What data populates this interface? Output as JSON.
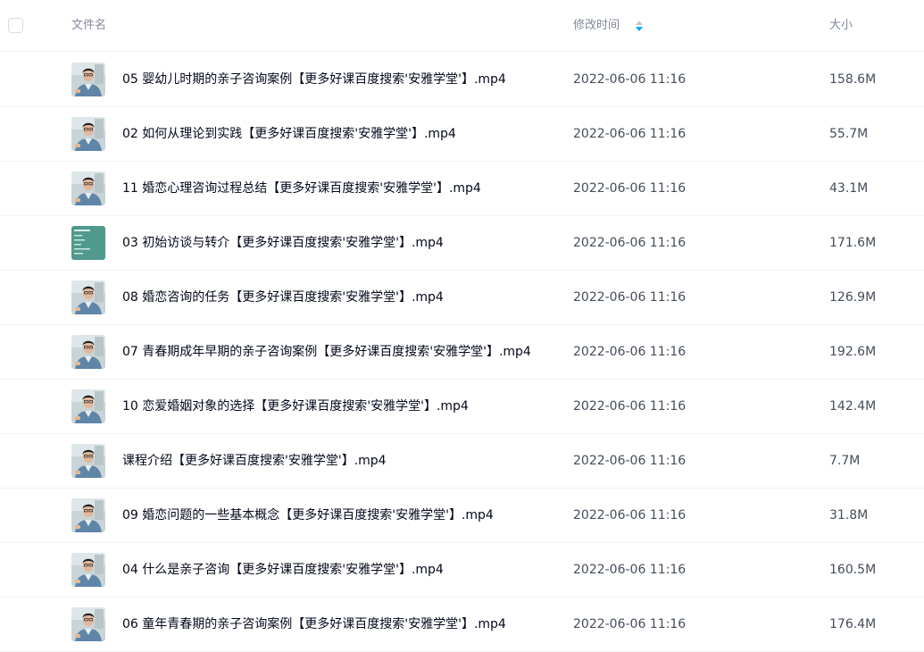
{
  "header": {
    "name_label": "文件名",
    "time_label": "修改时间",
    "size_label": "大小",
    "accent_color": "#06a7ff"
  },
  "files": [
    {
      "name": "05 婴幼儿时期的亲子咨询案例【更多好课百度搜索'安雅学堂'】.mp4",
      "time": "2022-06-06 11:16",
      "size": "158.6M",
      "thumb": "person"
    },
    {
      "name": "02 如何从理论到实践【更多好课百度搜索'安雅学堂'】.mp4",
      "time": "2022-06-06 11:16",
      "size": "55.7M",
      "thumb": "person"
    },
    {
      "name": "11 婚恋心理咨询过程总结【更多好课百度搜索'安雅学堂'】.mp4",
      "time": "2022-06-06 11:16",
      "size": "43.1M",
      "thumb": "person"
    },
    {
      "name": "03 初始访谈与转介【更多好课百度搜索'安雅学堂'】.mp4",
      "time": "2022-06-06 11:16",
      "size": "171.6M",
      "thumb": "slide"
    },
    {
      "name": "08 婚恋咨询的任务【更多好课百度搜索'安雅学堂'】.mp4",
      "time": "2022-06-06 11:16",
      "size": "126.9M",
      "thumb": "person"
    },
    {
      "name": "07 青春期成年早期的亲子咨询案例【更多好课百度搜索'安雅学堂'】.mp4",
      "time": "2022-06-06 11:16",
      "size": "192.6M",
      "thumb": "person"
    },
    {
      "name": "10 恋爱婚姻对象的选择【更多好课百度搜索'安雅学堂'】.mp4",
      "time": "2022-06-06 11:16",
      "size": "142.4M",
      "thumb": "person"
    },
    {
      "name": "课程介绍【更多好课百度搜索'安雅学堂'】.mp4",
      "time": "2022-06-06 11:16",
      "size": "7.7M",
      "thumb": "person"
    },
    {
      "name": "09 婚恋问题的一些基本概念【更多好课百度搜索'安雅学堂'】.mp4",
      "time": "2022-06-06 11:16",
      "size": "31.8M",
      "thumb": "person"
    },
    {
      "name": "04 什么是亲子咨询【更多好课百度搜索'安雅学堂'】.mp4",
      "time": "2022-06-06 11:16",
      "size": "160.5M",
      "thumb": "person"
    },
    {
      "name": "06 童年青春期的亲子咨询案例【更多好课百度搜索'安雅学堂'】.mp4",
      "time": "2022-06-06 11:16",
      "size": "176.4M",
      "thumb": "person"
    }
  ]
}
